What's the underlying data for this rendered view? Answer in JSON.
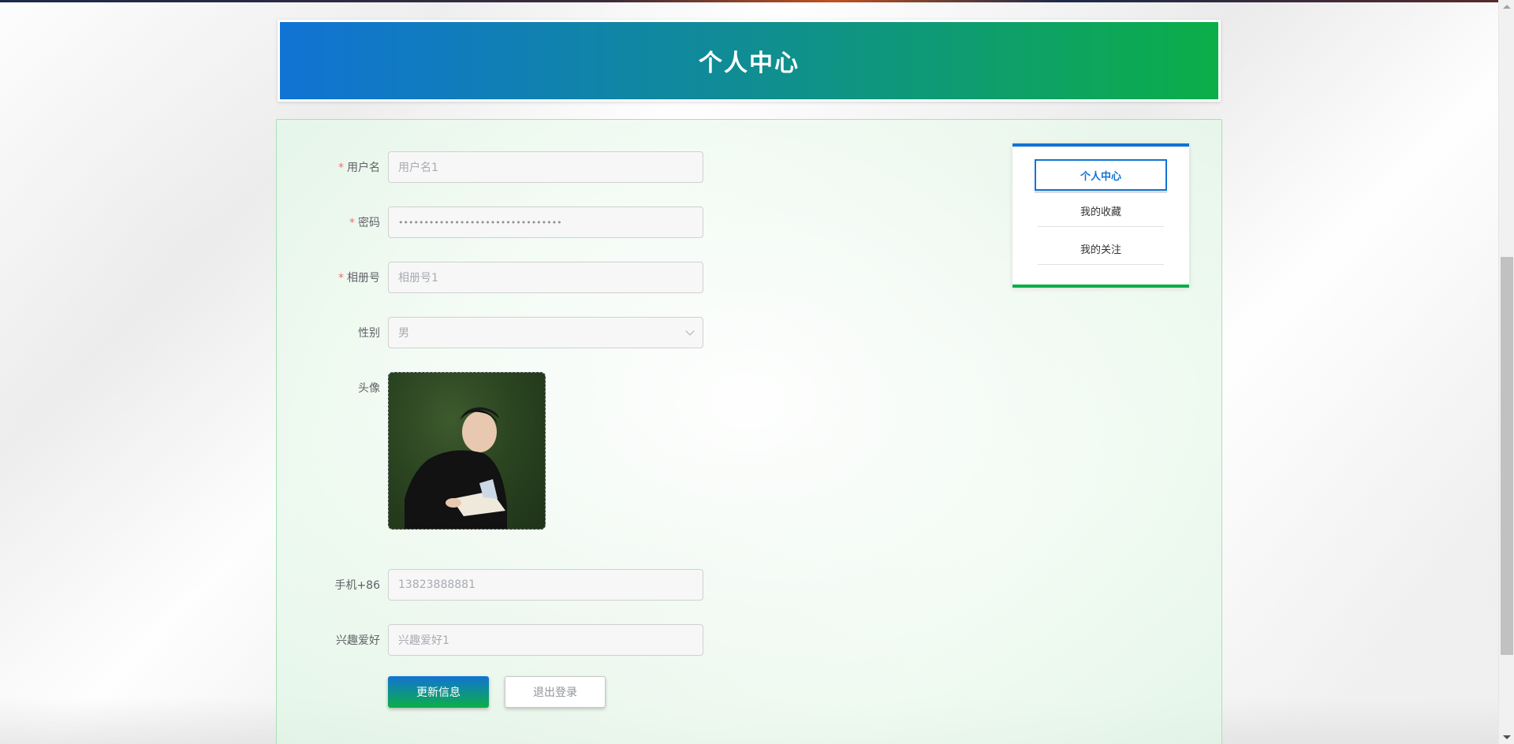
{
  "header": {
    "title": "个人中心"
  },
  "form": {
    "username": {
      "label": "用户名",
      "required": true,
      "placeholder": "用户名1"
    },
    "password": {
      "label": "密码",
      "required": true,
      "value": "••••••••••••••••••••••••••••••••"
    },
    "album": {
      "label": "相册号",
      "required": true,
      "placeholder": "相册号1"
    },
    "gender": {
      "label": "性别",
      "value": "男"
    },
    "avatar": {
      "label": "头像"
    },
    "phone": {
      "label": "手机+86",
      "placeholder": "13823888881"
    },
    "hobby": {
      "label": "兴趣爱好",
      "placeholder": "兴趣爱好1"
    },
    "required_mark": "*"
  },
  "buttons": {
    "update": "更新信息",
    "logout": "退出登录"
  },
  "side_menu": {
    "items": [
      {
        "label": "个人中心",
        "active": true
      },
      {
        "label": "我的收藏",
        "active": false
      },
      {
        "label": "我的关注",
        "active": false
      }
    ]
  },
  "colors": {
    "primary_blue": "#1173d4",
    "primary_green": "#0cae48",
    "required_red": "#f56c6c"
  },
  "icons": {
    "select": "chevron-down-icon"
  }
}
